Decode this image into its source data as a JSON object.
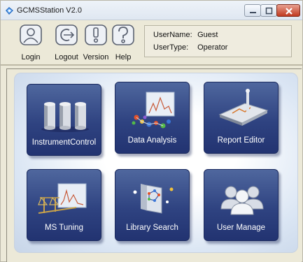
{
  "window": {
    "title": "GCMSStation V2.0"
  },
  "toolbar": {
    "login_label": "Login",
    "logout_label": "Logout",
    "version_label": "Version",
    "help_label": "Help"
  },
  "user_info": {
    "username_label": "UserName:",
    "username_value": "Guest",
    "usertype_label": "UserType:",
    "usertype_value": "Operator"
  },
  "modules": [
    {
      "label": "InstrumentControl",
      "icon": "instrument-control-icon"
    },
    {
      "label": "Data Analysis",
      "icon": "data-analysis-icon"
    },
    {
      "label": "Report Editor",
      "icon": "report-editor-icon"
    },
    {
      "label": "MS Tuning",
      "icon": "ms-tuning-icon"
    },
    {
      "label": "Library Search",
      "icon": "library-search-icon"
    },
    {
      "label": "User Manage",
      "icon": "user-manage-icon"
    }
  ],
  "colors": {
    "tile_top": "#4f679e",
    "tile_bottom": "#223371",
    "close_button": "#c0391f"
  }
}
